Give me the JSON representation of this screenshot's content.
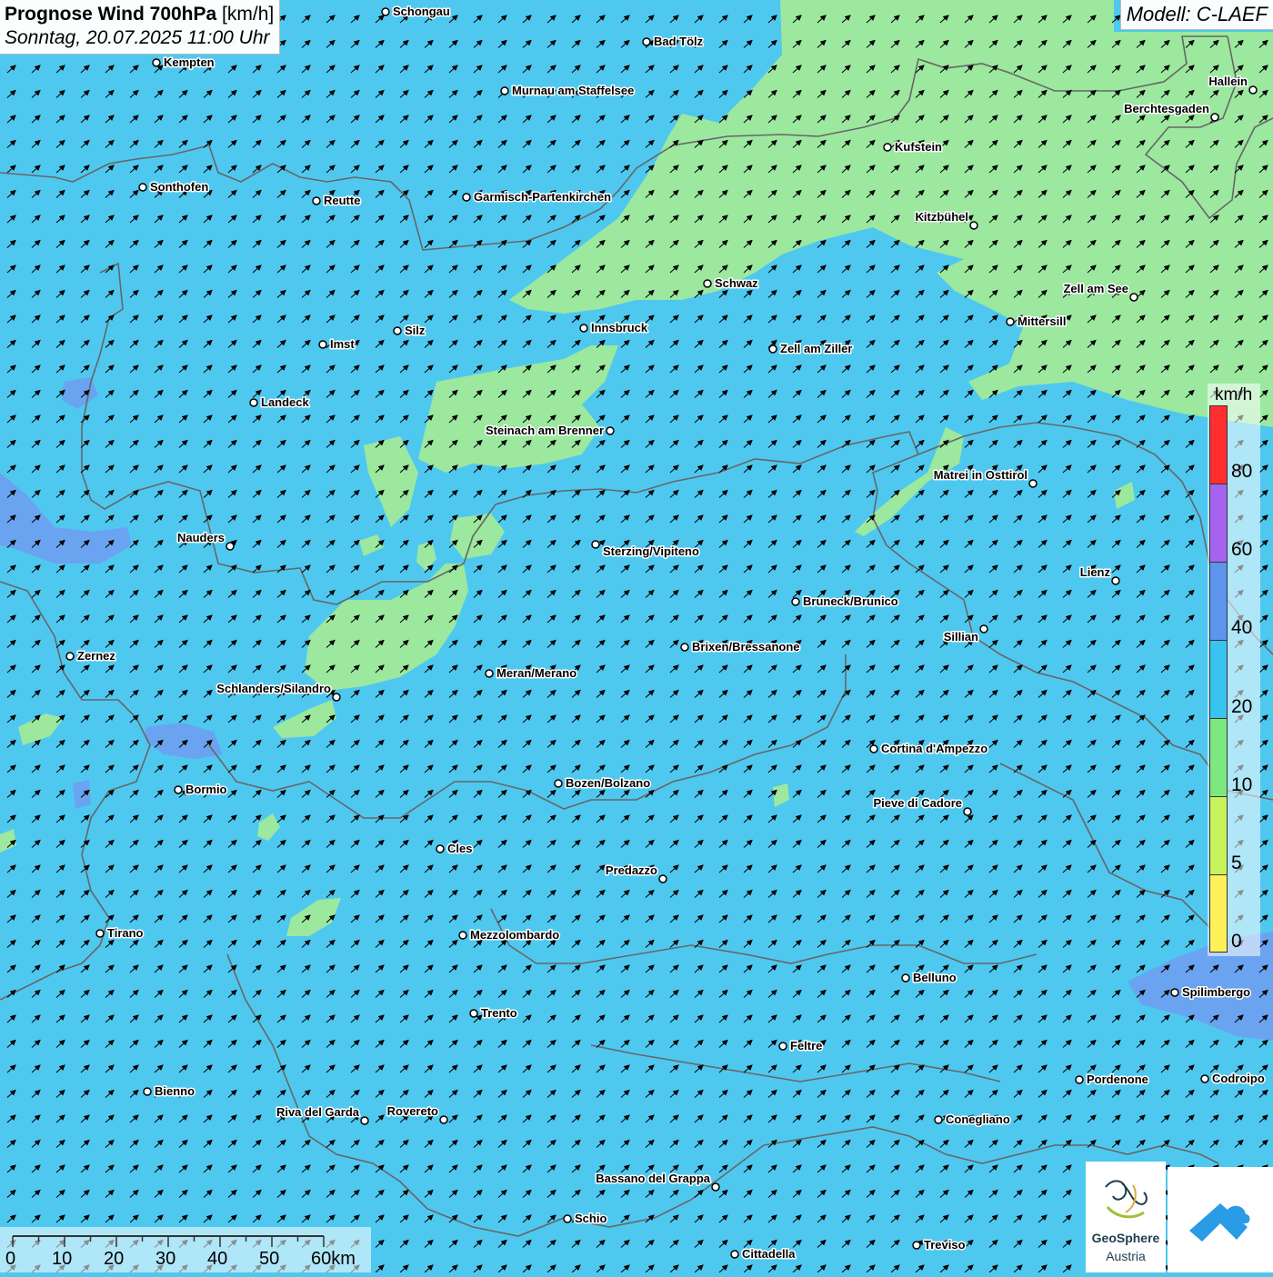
{
  "header": {
    "title_bold": "Prognose Wind 700hPa",
    "title_unit": "[km/h]",
    "subtitle": "Sonntag, 20.07.2025 11:00 Uhr"
  },
  "model_label": "Modell: C-LAEF",
  "legend": {
    "unit": "km/h",
    "ticks": [
      "80",
      "60",
      "40",
      "20",
      "10",
      "5",
      "0"
    ],
    "colors": [
      "#ff2f2f",
      "#a663f0",
      "#5c94ee",
      "#39c3ef",
      "#7de87f",
      "#c8f25a",
      "#fff05a"
    ]
  },
  "scalebar": {
    "labels": [
      "0",
      "10",
      "20",
      "30",
      "40",
      "50",
      "60km"
    ]
  },
  "branding": {
    "geo_name": "GeoSphere",
    "geo_country": "Austria"
  },
  "colors": {
    "base_20_40": "#4fc8f0",
    "band_10_20": "#a0ea9a",
    "band_40_60": "#6f9cf0",
    "border_line": "#666666"
  },
  "map": {
    "wind_direction": "south-west",
    "cities": [
      "Schongau",
      "Bad Tölz",
      "Kempten",
      "Hallein",
      "Murnau am Staffelsee",
      "Berchtesgaden",
      "Kufstein",
      "Sonthofen",
      "Reutte",
      "Garmisch-Partenkirchen",
      "Kitzbühel",
      "Schwaz",
      "Zell am See",
      "Innsbruck",
      "Mittersill",
      "Silz",
      "Imst",
      "Zell am Ziller",
      "Landeck",
      "Steinach am Brenner",
      "Matrei in Osttirol",
      "Nauders",
      "Sterzing/Vipiteno",
      "Lienz",
      "Bruneck/Brunico",
      "Sillian",
      "Zernez",
      "Brixen/Bressanone",
      "Meran/Merano",
      "Schlanders/Silandro",
      "Cortina d'Ampezzo",
      "Bozen/Bolzano",
      "Bormio",
      "Pieve di Cadore",
      "Cles",
      "Predazzo",
      "Tirano",
      "Mezzolombardo",
      "Belluno",
      "Spilimbergo",
      "Trento",
      "Feltre",
      "Pordenone",
      "Codroipo",
      "Bienno",
      "Riva del Garda",
      "Rovereto",
      "Conegliano",
      "Bassano del Grappa",
      "Schio",
      "Treviso",
      "Cittadella"
    ]
  }
}
